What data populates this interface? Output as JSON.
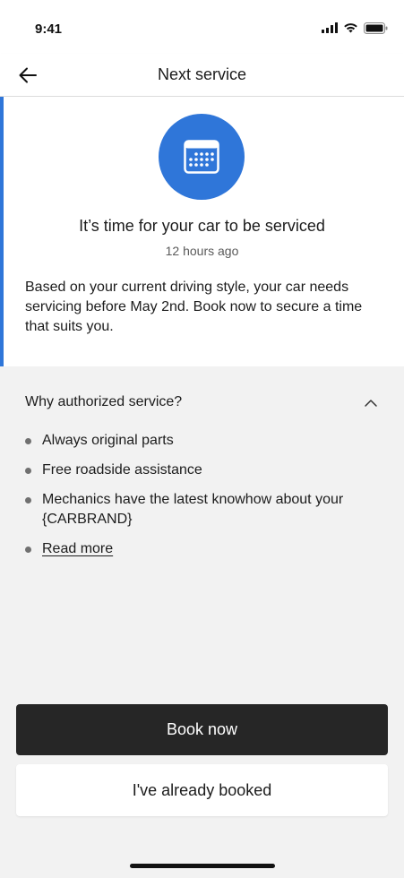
{
  "status_bar": {
    "time": "9:41",
    "icons": [
      "signal-icon",
      "wifi-icon",
      "battery-icon"
    ]
  },
  "header": {
    "title": "Next service",
    "back_icon": "arrow-left-icon"
  },
  "card": {
    "icon": "calendar-icon",
    "title": "It’s time for your car to be serviced",
    "time": "12 hours ago",
    "body": "Based on your current driving style, your car needs servicing before May 2nd. Book now to secure a time that suits you."
  },
  "why": {
    "title": "Why authorized service?",
    "expanded": true,
    "items": [
      "Always original parts",
      "Free roadside assistance",
      "Mechanics have the latest knowhow about your {CARBRAND}"
    ],
    "read_more": "Read more"
  },
  "actions": {
    "primary_label": "Book now",
    "secondary_label": "I've already booked"
  },
  "colors": {
    "accent": "#2f76d9",
    "primary_button": "#262626",
    "background": "#f2f2f2"
  }
}
